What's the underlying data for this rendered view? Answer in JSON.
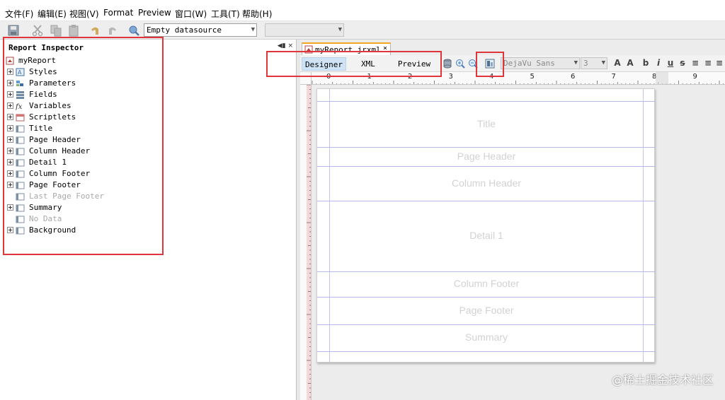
{
  "menubar": {
    "items": [
      "文件(F)",
      "编辑(E)",
      "视图(V)",
      "Format",
      "Preview",
      "窗口(W)",
      "工具(T)",
      "帮助(H)"
    ]
  },
  "toolbar": {
    "datasource_value": "Empty datasource",
    "icons": [
      "save-icon",
      "cut-icon",
      "copy-icon",
      "paste-icon",
      "undo-icon",
      "redo-icon",
      "datasource-icon"
    ]
  },
  "inspector": {
    "title": "Report Inspector",
    "root": "myReport",
    "nodes": [
      {
        "label": "Styles",
        "icon": "styles-icon",
        "expandable": true,
        "dim": false
      },
      {
        "label": "Parameters",
        "icon": "parameters-icon",
        "expandable": true,
        "dim": false
      },
      {
        "label": "Fields",
        "icon": "fields-icon",
        "expandable": true,
        "dim": false
      },
      {
        "label": "Variables",
        "icon": "variables-icon",
        "expandable": true,
        "dim": false
      },
      {
        "label": "Scriptlets",
        "icon": "scriptlets-icon",
        "expandable": true,
        "dim": false
      },
      {
        "label": "Title",
        "icon": "band-icon",
        "expandable": true,
        "dim": false
      },
      {
        "label": "Page Header",
        "icon": "band-icon",
        "expandable": true,
        "dim": false
      },
      {
        "label": "Column Header",
        "icon": "band-icon",
        "expandable": true,
        "dim": false
      },
      {
        "label": "Detail 1",
        "icon": "band-icon",
        "expandable": true,
        "dim": false
      },
      {
        "label": "Column Footer",
        "icon": "band-icon",
        "expandable": true,
        "dim": false
      },
      {
        "label": "Page Footer",
        "icon": "band-icon",
        "expandable": true,
        "dim": false
      },
      {
        "label": "Last Page Footer",
        "icon": "band-icon",
        "expandable": false,
        "dim": true
      },
      {
        "label": "Summary",
        "icon": "band-icon",
        "expandable": true,
        "dim": false
      },
      {
        "label": "No Data",
        "icon": "band-icon",
        "expandable": false,
        "dim": true
      },
      {
        "label": "Background",
        "icon": "band-icon",
        "expandable": true,
        "dim": false
      }
    ]
  },
  "editor": {
    "tab_label": "myReport.jrxml",
    "tab_close": "×",
    "modes": [
      "Designer",
      "XML",
      "Preview"
    ],
    "active_mode": "Designer",
    "font_family": "DejaVu Sans",
    "font_size": "3",
    "ruler_numbers": [
      "0",
      "1",
      "2",
      "3",
      "4",
      "5",
      "6",
      "7",
      "8",
      "9"
    ]
  },
  "report": {
    "bands": [
      "Title",
      "Page Header",
      "Column Header",
      "Detail 1",
      "Column Footer",
      "Page Footer",
      "Summary"
    ]
  },
  "watermark": "@稀土掘金技术社区",
  "colors": {
    "highlight": "#e0353a",
    "active_tab_accent": "#f5a623",
    "band_line": "#b8b8e8"
  }
}
